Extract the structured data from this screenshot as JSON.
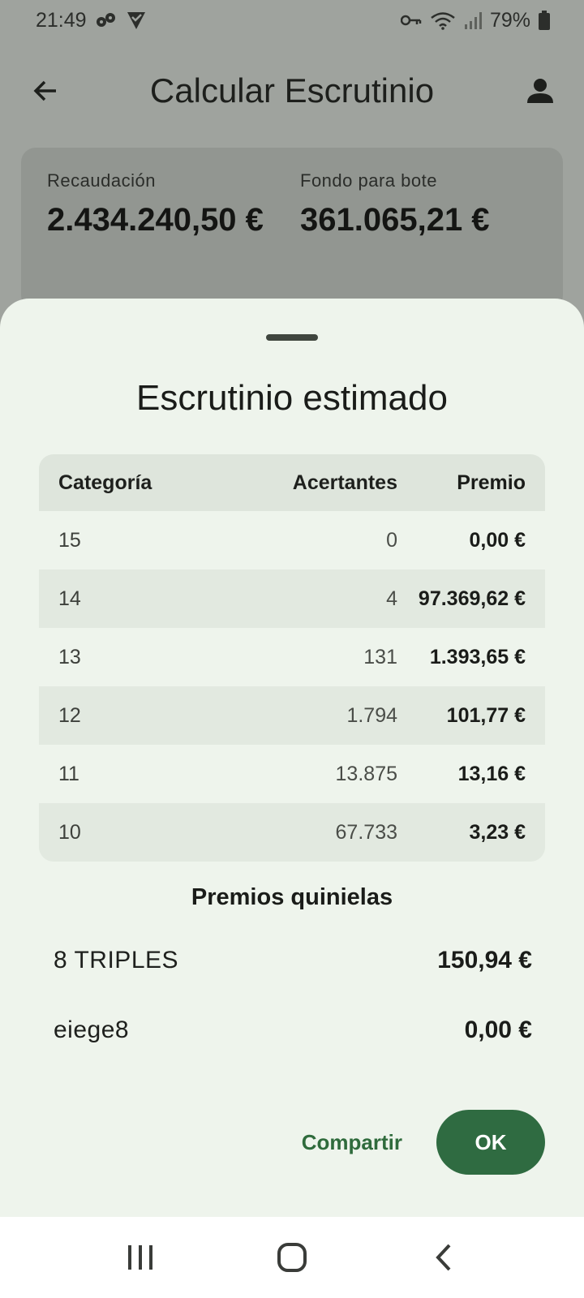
{
  "status_bar": {
    "time": "21:49",
    "battery": "79%"
  },
  "app_bar": {
    "title": "Calcular Escrutinio"
  },
  "summary": {
    "recaudacion_label": "Recaudación",
    "recaudacion_value": "2.434.240,50 €",
    "fondo_label": "Fondo para bote",
    "fondo_value": "361.065,21 €"
  },
  "sheet": {
    "title": "Escrutinio estimado",
    "table": {
      "headers": {
        "categoria": "Categoría",
        "acertantes": "Acertantes",
        "premio": "Premio"
      },
      "rows": [
        {
          "categoria": "15",
          "acertantes": "0",
          "premio": "0,00 €"
        },
        {
          "categoria": "14",
          "acertantes": "4",
          "premio": "97.369,62 €"
        },
        {
          "categoria": "13",
          "acertantes": "131",
          "premio": "1.393,65 €"
        },
        {
          "categoria": "12",
          "acertantes": "1.794",
          "premio": "101,77 €"
        },
        {
          "categoria": "11",
          "acertantes": "13.875",
          "premio": "13,16 €"
        },
        {
          "categoria": "10",
          "acertantes": "67.733",
          "premio": "3,23 €"
        }
      ]
    },
    "quinielas_title": "Premios quinielas",
    "quinielas": [
      {
        "name": "8 TRIPLES",
        "prize": "150,94 €"
      },
      {
        "name": "eiege8",
        "prize": "0,00 €"
      }
    ],
    "actions": {
      "share_label": "Compartir",
      "ok_label": "OK"
    }
  },
  "icons": {
    "back": "arrow-back-icon",
    "account": "person-icon",
    "nav_recents": "recents-icon",
    "nav_home": "home-icon",
    "nav_back": "nav-back-icon"
  },
  "colors": {
    "accent": "#2f6b41",
    "sheet_background": "#eef4ec",
    "scrim": "#9fa39e"
  }
}
